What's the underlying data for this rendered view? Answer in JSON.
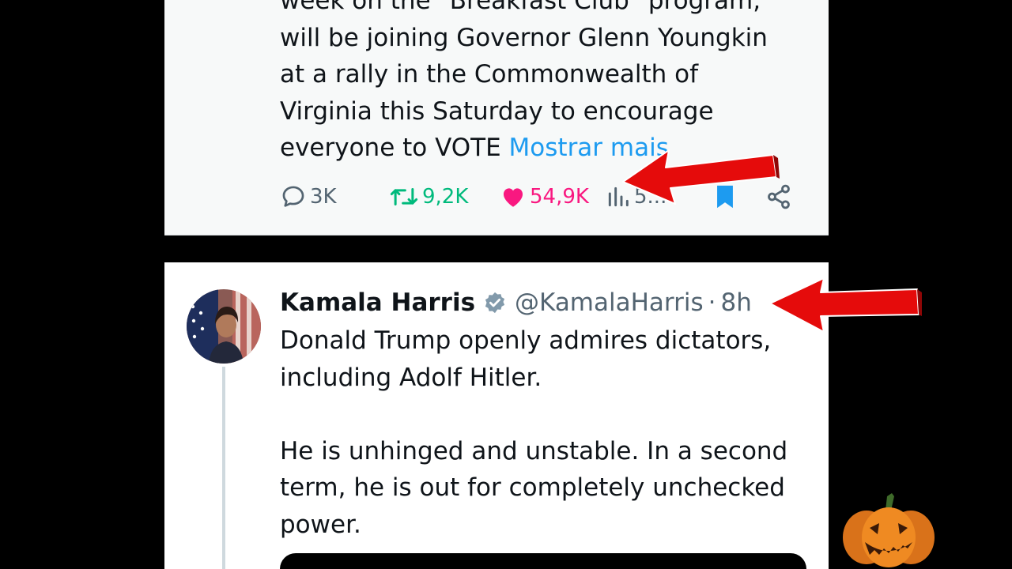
{
  "tweet_top": {
    "text": "week on the \"Breakfast Club\" program,\nwill be joining Governor Glenn Youngkin\nat a rally in the Commonwealth of\nVirginia this Saturday to encourage\neveryone to VOTE ",
    "show_more": "Mostrar mais",
    "replies": "3K",
    "retweets": "9,2K",
    "likes": "54,9K",
    "views": "5..."
  },
  "tweet_bottom": {
    "name": "Kamala Harris",
    "handle": "@KamalaHarris",
    "separator": "·",
    "time": "8h",
    "text": "Donald Trump openly admires dictators,\nincluding Adolf Hitler.\n\nHe is unhinged and unstable. In a second\nterm, he is out for completely unchecked\npower."
  },
  "icons": {
    "reply": "speech-bubble-icon",
    "retweet": "retweet-icon",
    "like": "heart-icon",
    "views": "bar-chart-icon",
    "bookmark": "bookmark-icon",
    "share": "share-icon",
    "verified": "verified-badge-icon",
    "arrow": "red-arrow-icon",
    "pumpkin": "jack-o-lantern-icon"
  },
  "colors": {
    "retweet": "#00ba7c",
    "like": "#f91880",
    "link": "#1d9bf0",
    "bookmark": "#1d9bf0",
    "muted": "#536471",
    "arrow": "#e50b0b"
  }
}
